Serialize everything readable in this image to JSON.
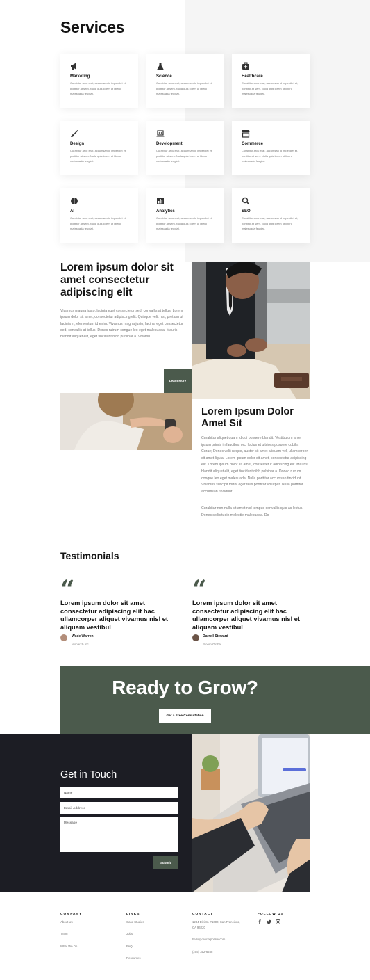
{
  "services": {
    "title": "Services",
    "cards": [
      {
        "icon": "megaphone-icon",
        "title": "Marketing",
        "desc": "Curabitur arcu erat, accumsan id imperdiet et, porttitor at sem. Nulla quis lorem ut libero malesuada feugiat."
      },
      {
        "icon": "flask-icon",
        "title": "Science",
        "desc": "Curabitur arcu erat, accumsan id imperdiet et, porttitor at sem. Nulla quis lorem ut libero malesuada feugiat."
      },
      {
        "icon": "medkit-icon",
        "title": "Healthcare",
        "desc": "Curabitur arcu erat, accumsan id imperdiet et, porttitor at sem. Nulla quis lorem ut libero malesuada feugiat."
      },
      {
        "icon": "brush-icon",
        "title": "Design",
        "desc": "Curabitur arcu erat, accumsan id imperdiet et, porttitor at sem. Nulla quis lorem ut libero malesuada feugiat."
      },
      {
        "icon": "laptop-code-icon",
        "title": "Development",
        "desc": "Curabitur arcu erat, accumsan id imperdiet et, porttitor at sem. Nulla quis lorem ut libero malesuada feugiat."
      },
      {
        "icon": "store-icon",
        "title": "Commerce",
        "desc": "Curabitur arcu erat, accumsan id imperdiet et, porttitor at sem. Nulla quis lorem ut libero malesuada feugiat."
      },
      {
        "icon": "brain-icon",
        "title": "AI",
        "desc": "Curabitur arcu erat, accumsan id imperdiet et, porttitor at sem. Nulla quis lorem ut libero malesuada feugiat."
      },
      {
        "icon": "chart-icon",
        "title": "Analytics",
        "desc": "Curabitur arcu erat, accumsan id imperdiet et, porttitor at sem. Nulla quis lorem ut libero malesuada feugiat."
      },
      {
        "icon": "search-icon",
        "title": "SEO",
        "desc": "Curabitur arcu erat, accumsan id imperdiet et, porttitor at sem. Nulla quis lorem ut libero malesuada feugiat."
      }
    ]
  },
  "about": {
    "heading": "Lorem ipsum dolor sit amet consectetur adipiscing elit",
    "body": "Vivamus magna justo, lacinia eget consectetur sed, convallis at tellus. Lorem ipsum dolor sit amet, consectetur adipiscing elit. Quisque velit nisi, pretium ut lacinia in, elementum id enim. Vivamus magna justo, lacinia eget consectetur sed, convallis at tellus. Donec rutrum congue leo eget malesuada. Mauris blandit aliquet elit, eget tincidunt nibh pulvinar a. Vivamu",
    "button": "Learn More",
    "heading2": "Lorem Ipsum Dolor Amet Sit",
    "body2": "Curabitur aliquet quam id dui posuere blandit. Vestibulum ante ipsum primis in faucibus orci luctus et ultrices posuere cubilia Curae; Donec velit neque, auctor sit amet aliquam vel, ullamcorper sit amet ligula. Lorem ipsum dolor sit amet, consectetur adipiscing elit. Lorem ipsum dolor sit amet, consectetur adipiscing elit. Mauris blandit aliquet elit, eget tincidunt nibh pulvinar a. Donec rutrum congue leo eget malesuada. Nulla porttitor accumsan tincidunt. Vivamus suscipit tortor eget felis porttitor volutpat. Nulla porttitor accumsan tincidunt.",
    "body3": "Curabitur non nulla sit amet nisl tempus convallis quis ac lectus. Donec sollicitudin molestie malesuada. Do"
  },
  "testimonials": {
    "title": "Testimonials",
    "items": [
      {
        "text": "Lorem ipsum dolor sit amet consectetur adipiscing elit hac ullamcorper aliquet vivamus nisl et aliquam vestibul",
        "name": "Wade Warren",
        "role": "Monarch Inc."
      },
      {
        "text": "Lorem ipsum dolor sit amet consectetur adipiscing elit hac ullamcorper aliquet vivamus nisl et aliquam vestibul",
        "name": "Darrell Steward",
        "role": "Bloom Global"
      }
    ]
  },
  "cta": {
    "heading": "Ready to Grow?",
    "button": "Get a Free Consultation"
  },
  "contact": {
    "title": "Get in Touch",
    "name_placeholder": "Name",
    "email_placeholder": "Email Address",
    "message_placeholder": "Message",
    "submit": "Submit"
  },
  "footer": {
    "company": {
      "title": "COMPANY",
      "links": [
        "About Us",
        "Team",
        "What We Do"
      ]
    },
    "links": {
      "title": "LINKS",
      "links": [
        "Case Studies",
        "Jobs",
        "FAQ",
        "Resources"
      ]
    },
    "contact": {
      "title": "CONTACT",
      "address_line1": "1234 Divi St. #1000, San Francisco,",
      "address_line2": "CA 94220",
      "email": "hello@divicorporate.com",
      "phone": "(255) 352-6258"
    },
    "follow": {
      "title": "FOLLOW US",
      "icons": [
        "facebook-icon",
        "twitter-icon",
        "instagram-icon"
      ]
    }
  },
  "colors": {
    "accent": "#4b5a4c",
    "dark": "#1c1d24",
    "light_panel": "#f5f5f5"
  }
}
